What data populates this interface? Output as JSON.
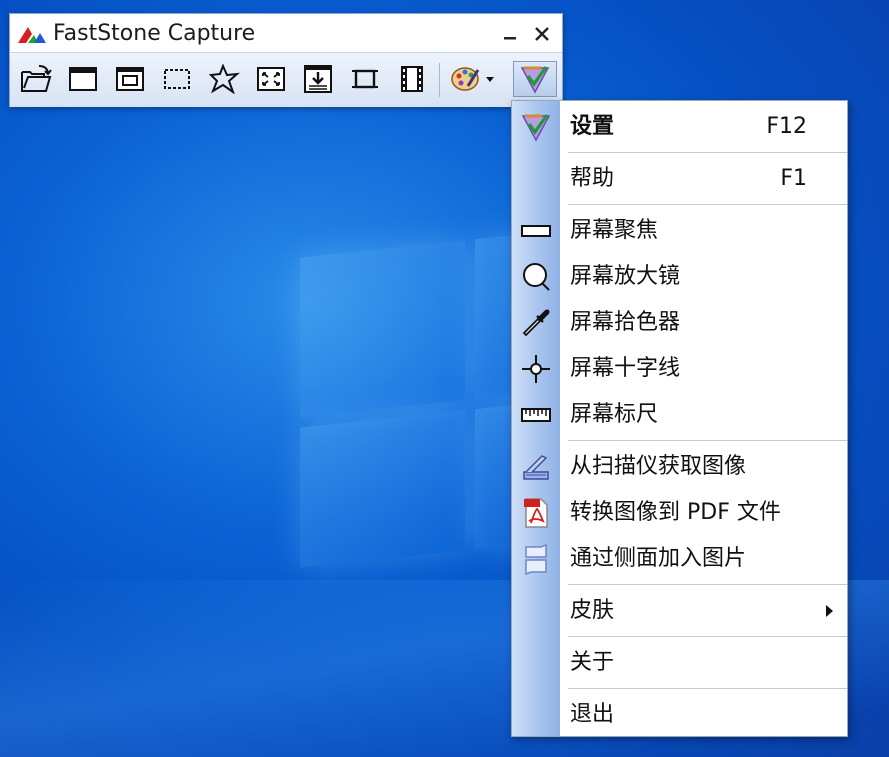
{
  "window": {
    "title": "FastStone Capture"
  },
  "toolbar": {
    "tools": [
      {
        "icon": "open-folder-icon"
      },
      {
        "icon": "capture-active-window-icon"
      },
      {
        "icon": "capture-window-object-icon"
      },
      {
        "icon": "capture-rectangle-icon"
      },
      {
        "icon": "capture-freehand-icon"
      },
      {
        "icon": "capture-fullscreen-icon"
      },
      {
        "icon": "capture-scrolling-icon"
      },
      {
        "icon": "capture-fixed-region-icon"
      },
      {
        "icon": "screen-recorder-icon"
      },
      {
        "icon": "output-palette-icon"
      },
      {
        "icon": "settings-menu-icon"
      }
    ]
  },
  "menu": {
    "items": [
      {
        "label": "设置",
        "shortcut": "F12",
        "icon": "settings-icon"
      },
      {
        "label": "帮助",
        "shortcut": "F1"
      },
      {
        "label": "屏幕聚焦",
        "icon": "screen-focus-icon"
      },
      {
        "label": "屏幕放大镜",
        "icon": "magnifier-icon"
      },
      {
        "label": "屏幕拾色器",
        "icon": "color-picker-icon"
      },
      {
        "label": "屏幕十字线",
        "icon": "crosshair-icon"
      },
      {
        "label": "屏幕标尺",
        "icon": "ruler-icon"
      },
      {
        "label": "从扫描仪获取图像",
        "icon": "scanner-icon"
      },
      {
        "label": "转换图像到 PDF 文件",
        "icon": "pdf-icon"
      },
      {
        "label": "通过侧面加入图片",
        "icon": "join-images-icon"
      },
      {
        "label": "皮肤",
        "submenu": true
      },
      {
        "label": "关于"
      },
      {
        "label": "退出"
      }
    ]
  },
  "colors": {
    "desktop": "#0b63d6",
    "menu_gutter": "#a9c5ee",
    "toolbar": "#d7e2f3"
  }
}
